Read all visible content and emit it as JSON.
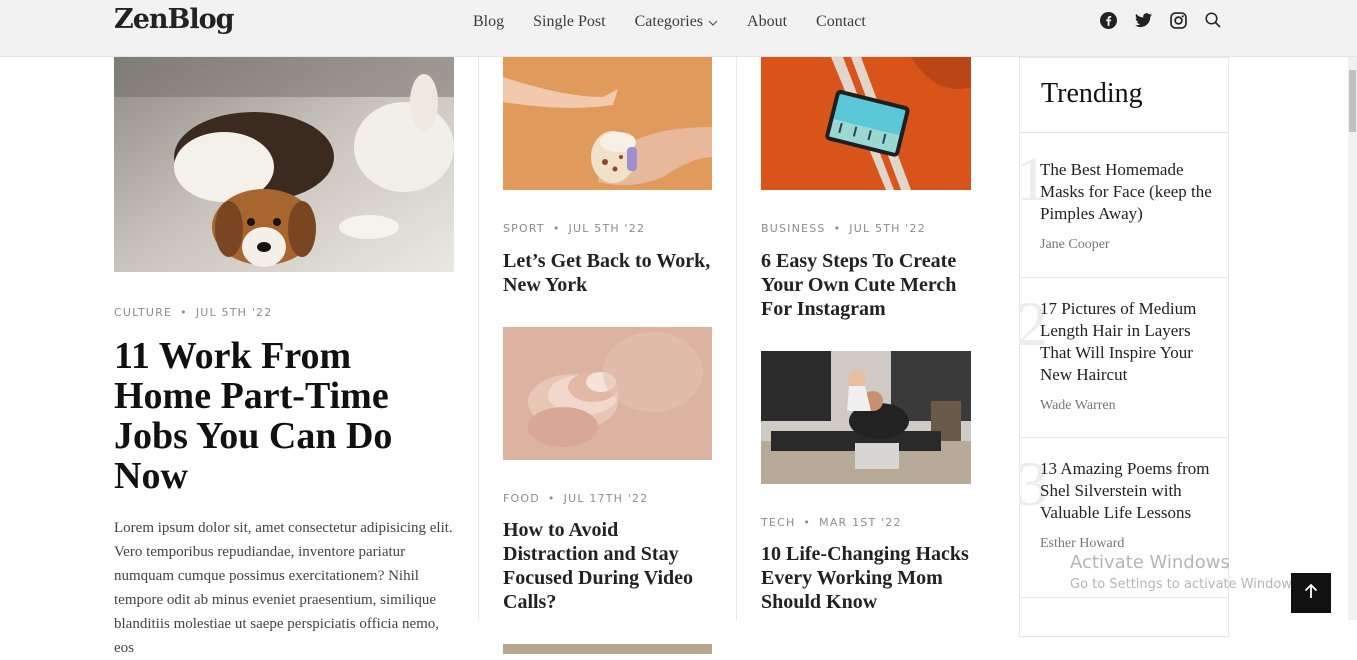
{
  "brand": "ZenBlog",
  "nav": [
    "Blog",
    "Single Post",
    "Categories",
    "About",
    "Contact"
  ],
  "icons": [
    "facebook-icon",
    "twitter-icon",
    "instagram-icon",
    "search-icon"
  ],
  "featured": {
    "category": "CULTURE",
    "date": "JUL 5TH '22",
    "title": "11 Work From Home Part-Time Jobs You Can Do Now",
    "excerpt": "Lorem ipsum dolor sit, amet consectetur adipisicing elit. Vero temporibus repudiandae, inventore pariatur numquam cumque possimus exercitationem? Nihil tempore odit ab minus eveniet praesentium, similique blanditiis molestiae ut saepe perspiciatis officia nemo, eos"
  },
  "col2": [
    {
      "category": "SPORT",
      "date": "JUL 5TH '22",
      "title": "Let’s Get Back to Work, New York"
    },
    {
      "category": "FOOD",
      "date": "JUL 17TH '22",
      "title": "How to Avoid Distraction and Stay Focused During Video Calls?"
    }
  ],
  "col3": [
    {
      "category": "BUSINESS",
      "date": "JUL 5TH '22",
      "title": "6 Easy Steps To Create Your Own Cute Merch For Instagram"
    },
    {
      "category": "TECH",
      "date": "MAR 1ST '22",
      "title": "10 Life-Changing Hacks Every Working Mom Should Know"
    }
  ],
  "trending": {
    "heading": "Trending",
    "items": [
      {
        "num": "1",
        "title": "The Best Homemade Masks for Face (keep the Pimples Away)",
        "author": "Jane Cooper"
      },
      {
        "num": "2",
        "title": "17 Pictures of Medium Length Hair in Layers That Will Inspire Your New Haircut",
        "author": "Wade Warren"
      },
      {
        "num": "3",
        "title": "13 Amazing Poems from Shel Silverstein with Valuable Life Lessons",
        "author": "Esther Howard"
      }
    ]
  },
  "watermark": {
    "line1": "Activate Windows",
    "line2": "Go to Settings to activate Windows."
  }
}
